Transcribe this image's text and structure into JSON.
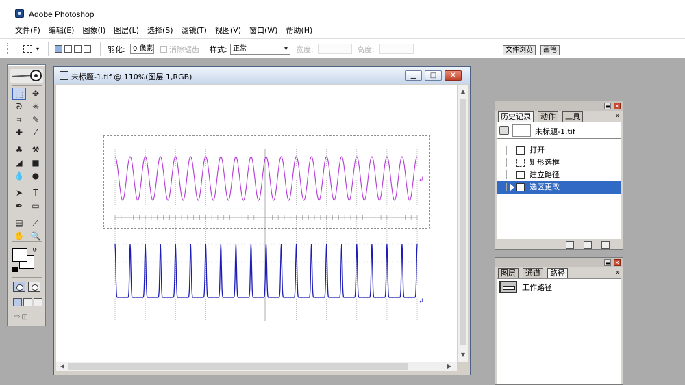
{
  "app": {
    "title": "Adobe Photoshop",
    "logo_icon": "photoshop-eye-icon"
  },
  "menu": [
    {
      "label": "文件(F)"
    },
    {
      "label": "编辑(E)"
    },
    {
      "label": "图象(I)"
    },
    {
      "label": "图层(L)"
    },
    {
      "label": "选择(S)"
    },
    {
      "label": "滤镜(T)"
    },
    {
      "label": "视图(V)"
    },
    {
      "label": "窗口(W)"
    },
    {
      "label": "帮助(H)"
    }
  ],
  "options_bar": {
    "feather_label": "羽化:",
    "feather_value": "0 像素",
    "antialias_label": "消除锯齿",
    "style_label": "样式:",
    "style_value": "正常",
    "width_label": "宽度:",
    "height_label": "高度:"
  },
  "palette_well": {
    "tabs": [
      {
        "label": "文件浏览"
      },
      {
        "label": "画笔"
      }
    ]
  },
  "document": {
    "title": "未标题-1.tif @ 110%(图层 1,RGB)",
    "minimize": "▁",
    "maximize": "□",
    "close": "✕",
    "colors": {
      "upper_signal": "#b33ad6",
      "lower_signal": "#1c1cb8",
      "grid": "#9a9a9a"
    }
  },
  "history_panel": {
    "tabs": [
      {
        "label": "历史记录"
      },
      {
        "label": "动作"
      },
      {
        "label": "工具"
      }
    ],
    "snapshot": "未标题-1.tif",
    "steps": [
      {
        "label": "打开",
        "selected": false
      },
      {
        "label": "矩形选框",
        "selected": false
      },
      {
        "label": "建立路径",
        "selected": false
      },
      {
        "label": "选区更改",
        "selected": true
      }
    ],
    "menu_arrow": "»"
  },
  "layers_panel": {
    "tabs": [
      {
        "label": "图层"
      },
      {
        "label": "通道"
      },
      {
        "label": "路径"
      }
    ],
    "path_name": "工作路径",
    "menu_arrow": "»"
  },
  "toolbox": {
    "tools": [
      {
        "icon": "⬚",
        "name": "marquee-tool-icon"
      },
      {
        "icon": "✥",
        "name": "move-tool-icon"
      },
      {
        "icon": "ᘐ",
        "name": "lasso-tool-icon"
      },
      {
        "icon": "✳",
        "name": "magic-wand-tool-icon"
      },
      {
        "icon": "⌗",
        "name": "crop-tool-icon"
      },
      {
        "icon": "✎",
        "name": "slice-tool-icon"
      },
      {
        "icon": "✚",
        "name": "healing-brush-tool-icon"
      },
      {
        "icon": "⁄",
        "name": "brush-tool-icon"
      },
      {
        "icon": "♣",
        "name": "clone-stamp-tool-icon"
      },
      {
        "icon": "⚒",
        "name": "history-brush-tool-icon"
      },
      {
        "icon": "◢",
        "name": "eraser-tool-icon"
      },
      {
        "icon": "■",
        "name": "gradient-tool-icon"
      },
      {
        "icon": "💧",
        "name": "blur-tool-icon"
      },
      {
        "icon": "●",
        "name": "dodge-tool-icon"
      },
      {
        "icon": "➤",
        "name": "path-selection-tool-icon"
      },
      {
        "icon": "T",
        "name": "type-tool-icon"
      },
      {
        "icon": "✒",
        "name": "pen-tool-icon"
      },
      {
        "icon": "▭",
        "name": "shape-tool-icon"
      },
      {
        "icon": "▤",
        "name": "notes-tool-icon"
      },
      {
        "icon": "⟋",
        "name": "eyedropper-tool-icon"
      },
      {
        "icon": "✋",
        "name": "hand-tool-icon"
      },
      {
        "icon": "🔍",
        "name": "zoom-tool-icon"
      }
    ]
  }
}
